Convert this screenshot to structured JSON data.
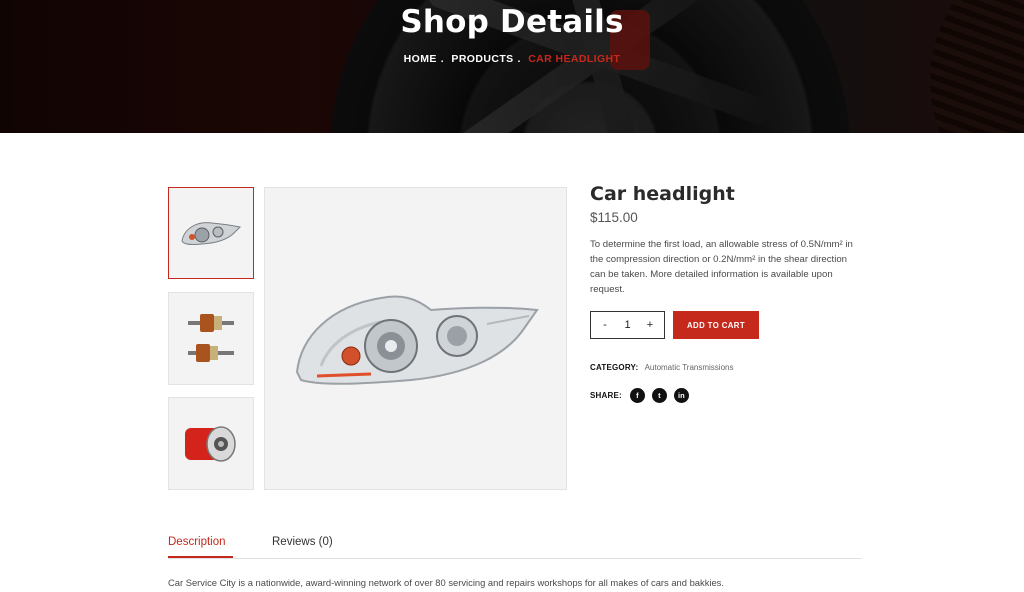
{
  "hero": {
    "title": "Shop Details",
    "breadcrumb": {
      "home": "HOME",
      "products": "PRODUCTS",
      "current": "CAR HEADLIGHT",
      "separator": "."
    }
  },
  "product": {
    "title": "Car headlight",
    "price": "$115.00",
    "description": "To determine the first load, an allowable stress of 0.5N/mm² in the compression direction or 0.2N/mm² in the shear direction can be taken. More detailed information is available upon request.",
    "quantity": {
      "minus": "-",
      "value": "1",
      "plus": "+"
    },
    "add_to_cart": "ADD TO CART",
    "category": {
      "label": "CATEGORY:",
      "value": "Automatic Transmissions"
    },
    "share": {
      "label": "SHARE:",
      "icons": [
        "facebook-icon",
        "twitter-icon",
        "linkedin-icon"
      ],
      "glyphs": [
        "f",
        "t",
        "in"
      ]
    }
  },
  "gallery": {
    "thumbnails": [
      "headlight",
      "armature-parts",
      "oil-filter"
    ],
    "selected": "headlight"
  },
  "tabs": {
    "items": [
      {
        "label": "Description"
      },
      {
        "label": "Reviews (0)"
      }
    ],
    "active_content": "Car Service City is a nationwide, award-winning network of over 80 servicing and repairs workshops for all makes of cars and bakkies."
  },
  "colors": {
    "accent": "#c4291c",
    "text": "#1e1e1e"
  }
}
